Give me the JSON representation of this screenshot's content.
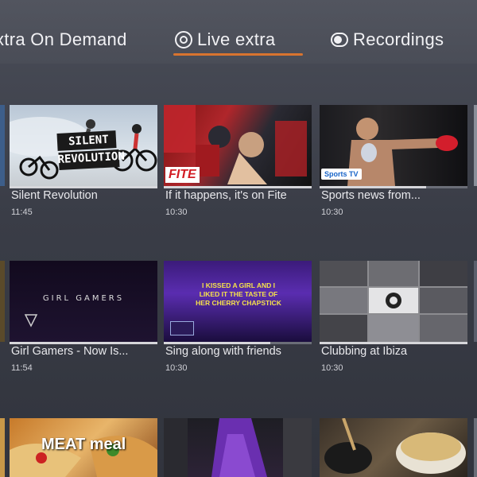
{
  "tabs": {
    "on_demand": "xtra On Demand",
    "live": "Live extra",
    "recordings": "Recordings"
  },
  "rows": [
    [
      {
        "title": "Silent Revolution",
        "time": "11:45",
        "art_text": "SILENT REVOLUTION",
        "progress": 1.0
      },
      {
        "title": "If it happens, it's on Fite",
        "time": "10:30",
        "art_text": "FITE",
        "progress": 1.0
      },
      {
        "title": "Sports news from...",
        "time": "10:30",
        "art_text": "Sports TV",
        "progress": 0.72
      }
    ],
    [
      {
        "title": "Girl Gamers - Now Is...",
        "time": "11:54",
        "art_text": "GIRL GAMERS",
        "progress": 1.0
      },
      {
        "title": "Sing along with friends",
        "time": "10:30",
        "art_text": "I KISSED A GIRL AND I LIKED IT THE TASTE OF HER CHERRY CHAPSTICK",
        "progress": 0.72
      },
      {
        "title": "Clubbing at Ibiza",
        "time": "10:30",
        "art_text": "",
        "progress": 1.0
      }
    ],
    [
      {
        "title": "",
        "time": "",
        "art_text": "MEAT meal",
        "progress": 0
      },
      {
        "title": "",
        "time": "",
        "art_text": "",
        "progress": 0
      },
      {
        "title": "",
        "time": "",
        "art_text": "",
        "progress": 0
      }
    ]
  ],
  "colors": {
    "accent": "#d9742f",
    "background": "#3a3d47"
  }
}
